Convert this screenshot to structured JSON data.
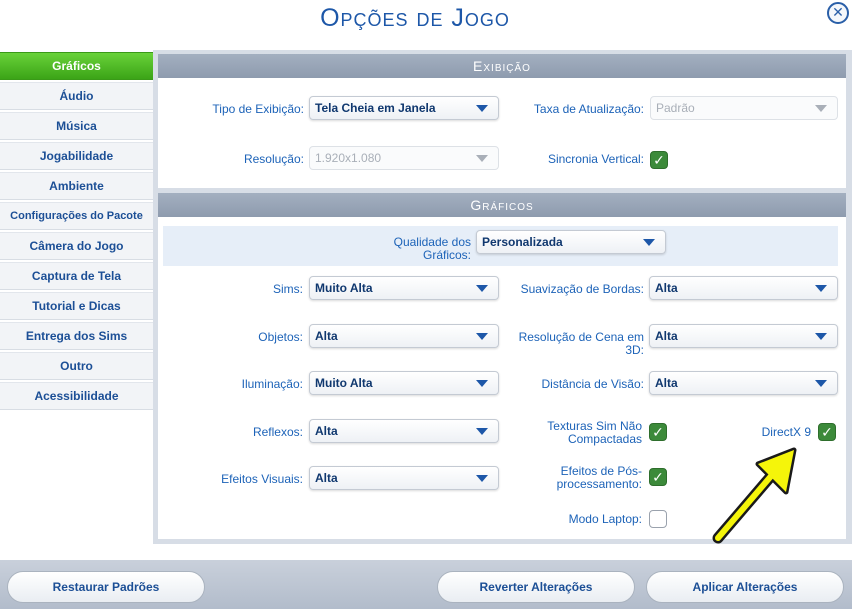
{
  "title": "Opções de Jogo",
  "sidebar": {
    "items": [
      {
        "label": "Gráficos"
      },
      {
        "label": "Áudio"
      },
      {
        "label": "Música"
      },
      {
        "label": "Jogabilidade"
      },
      {
        "label": "Ambiente"
      },
      {
        "label": "Configurações do Pacote"
      },
      {
        "label": "Câmera do Jogo"
      },
      {
        "label": "Captura de Tela"
      },
      {
        "label": "Tutorial e Dicas"
      },
      {
        "label": "Entrega dos Sims"
      },
      {
        "label": "Outro"
      },
      {
        "label": "Acessibilidade"
      }
    ],
    "active": "Gráficos"
  },
  "display": {
    "header": "Exibição",
    "display_type": {
      "label": "Tipo de Exibição:",
      "value": "Tela Cheia em Janela"
    },
    "refresh_rate": {
      "label": "Taxa de Atualização:",
      "value": "Padrão"
    },
    "resolution": {
      "label": "Resolução:",
      "value": "1.920x1.080"
    },
    "vsync": {
      "label": "Sincronia Vertical:",
      "checked": true
    }
  },
  "graphics": {
    "header": "Gráficos",
    "quality": {
      "label": "Qualidade dos Gráficos:",
      "value": "Personalizada"
    },
    "sims": {
      "label": "Sims:",
      "value": "Muito Alta"
    },
    "objects": {
      "label": "Objetos:",
      "value": "Alta"
    },
    "lighting": {
      "label": "Iluminação:",
      "value": "Muito Alta"
    },
    "reflections": {
      "label": "Reflexos:",
      "value": "Alta"
    },
    "visual_effects": {
      "label": "Efeitos Visuais:",
      "value": "Alta"
    },
    "edge_smoothing": {
      "label": "Suavização de Bordas:",
      "value": "Alta"
    },
    "scene_resolution": {
      "label": "Resolução de Cena em 3D:",
      "value": "Alta"
    },
    "view_distance": {
      "label": "Distância de Visão:",
      "value": "Alta"
    },
    "uncompressed_textures": {
      "label": "Texturas Sim Não Compactadas",
      "checked": true
    },
    "directx9": {
      "label": "DirectX 9",
      "checked": true
    },
    "post_processing": {
      "label": "Efeitos de Pós-processamento:",
      "checked": true
    },
    "laptop_mode": {
      "label": "Modo Laptop:",
      "checked": false
    }
  },
  "footer": {
    "restore_label": "Restaurar Padrões",
    "revert_label": "Reverter Alterações",
    "apply_label": "Aplicar Alterações"
  },
  "colors": {
    "accent": "#1d63b8",
    "active_tab": "#4fbb25",
    "checkbox": "#3c8a3a",
    "arrow_annotation": "#f5f50a"
  },
  "icons": {
    "close": "close-icon",
    "dropdown": "chevron-down-icon",
    "check": "check-icon",
    "annotation": "arrow-annotation-icon"
  }
}
